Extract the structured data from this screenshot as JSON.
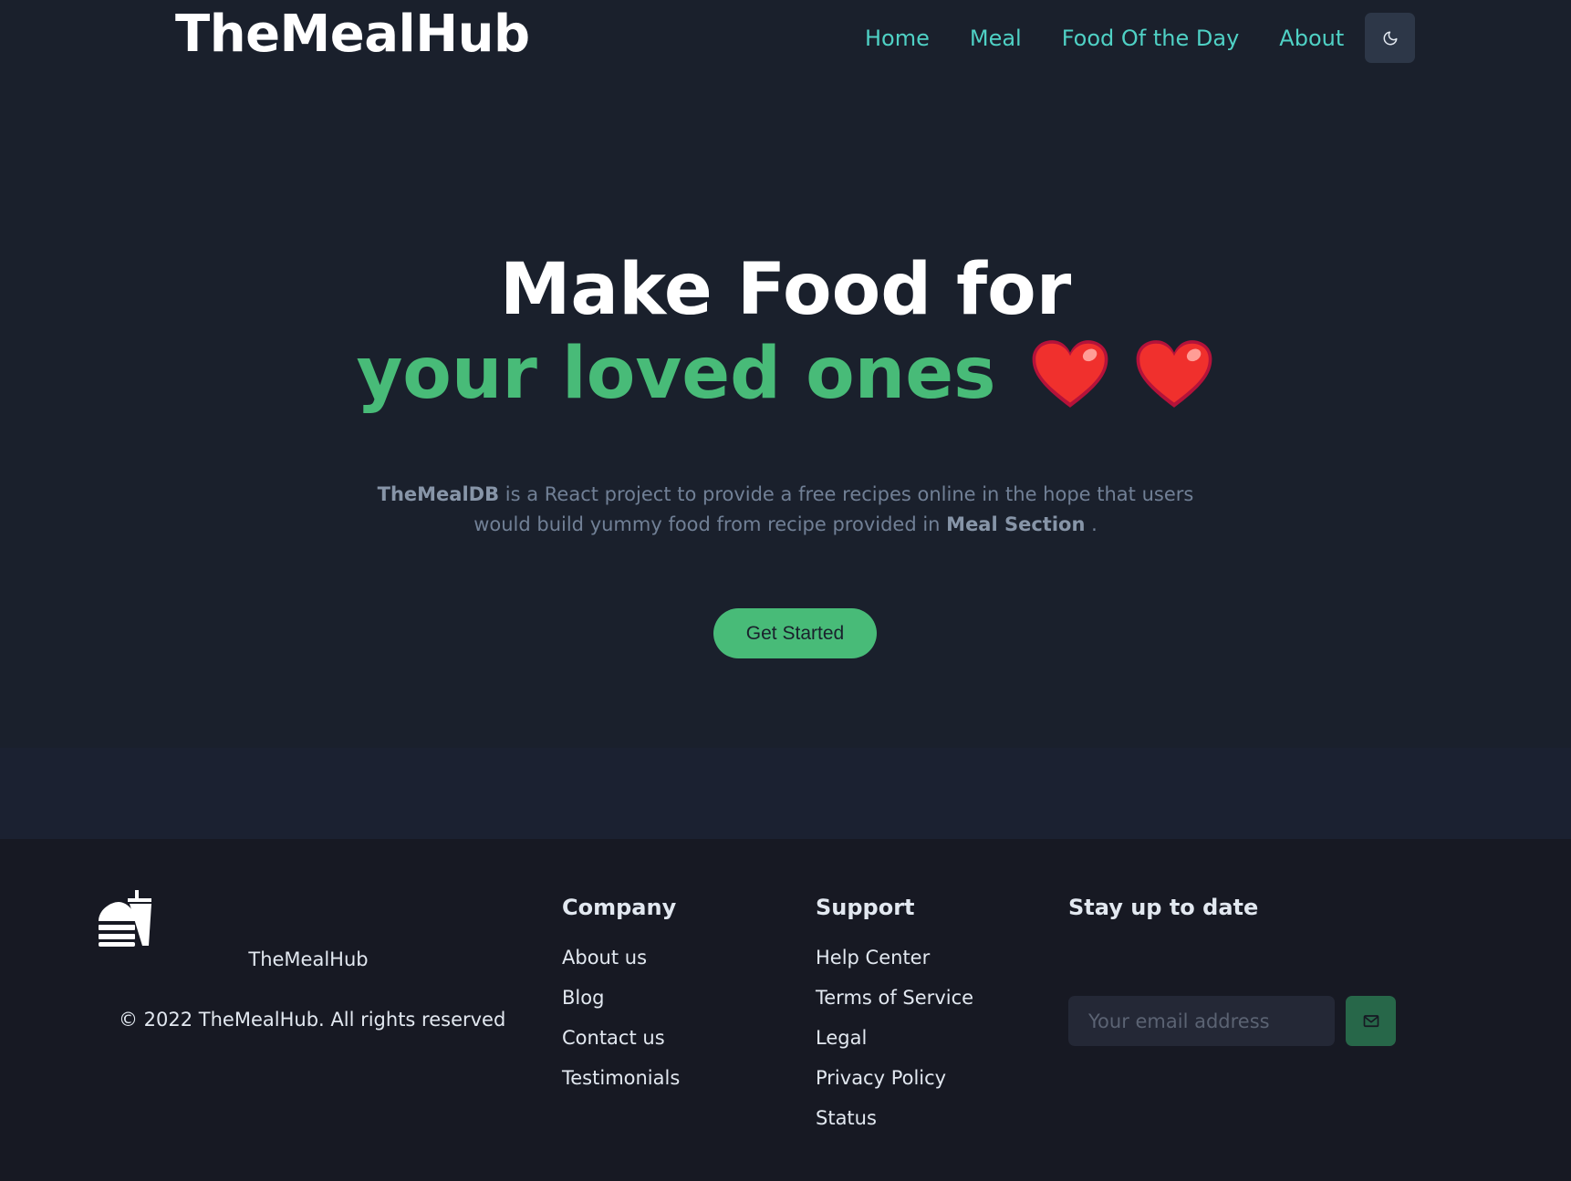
{
  "brand": "TheMealHub",
  "nav": {
    "items": [
      {
        "label": "Home"
      },
      {
        "label": "Meal"
      },
      {
        "label": "Food Of the Day"
      },
      {
        "label": "About"
      }
    ],
    "theme_toggle_icon": "moon-icon"
  },
  "hero": {
    "title_line1": "Make Food for",
    "title_line2": "your loved ones",
    "hearts": [
      "heart-icon",
      "heart-icon"
    ],
    "description": {
      "bold_start": "TheMealDB",
      "text_middle": " is a React project to provide a free recipes online in the hope that users would build yummy food from recipe provided in ",
      "bold_end": "Meal Section",
      "text_end": " ."
    },
    "cta_label": "Get Started"
  },
  "footer": {
    "logo_icon": "burger-drink-icon",
    "brand": "TheMealHub",
    "copyright": "© 2022 TheMealHub. All rights reserved",
    "company": {
      "heading": "Company",
      "links": [
        "About us",
        "Blog",
        "Contact us",
        "Testimonials"
      ]
    },
    "support": {
      "heading": "Support",
      "links": [
        "Help Center",
        "Terms of Service",
        "Legal",
        "Privacy Policy",
        "Status"
      ]
    },
    "subscribe": {
      "heading": "Stay up to date",
      "placeholder": "Your email address",
      "send_icon": "mail-send-icon"
    }
  },
  "colors": {
    "background": "#1a202c",
    "footer_bg": "#171923",
    "accent_green": "#48bb78",
    "nav_teal": "#4fd1c5",
    "heart_red": "#e53e3e"
  }
}
